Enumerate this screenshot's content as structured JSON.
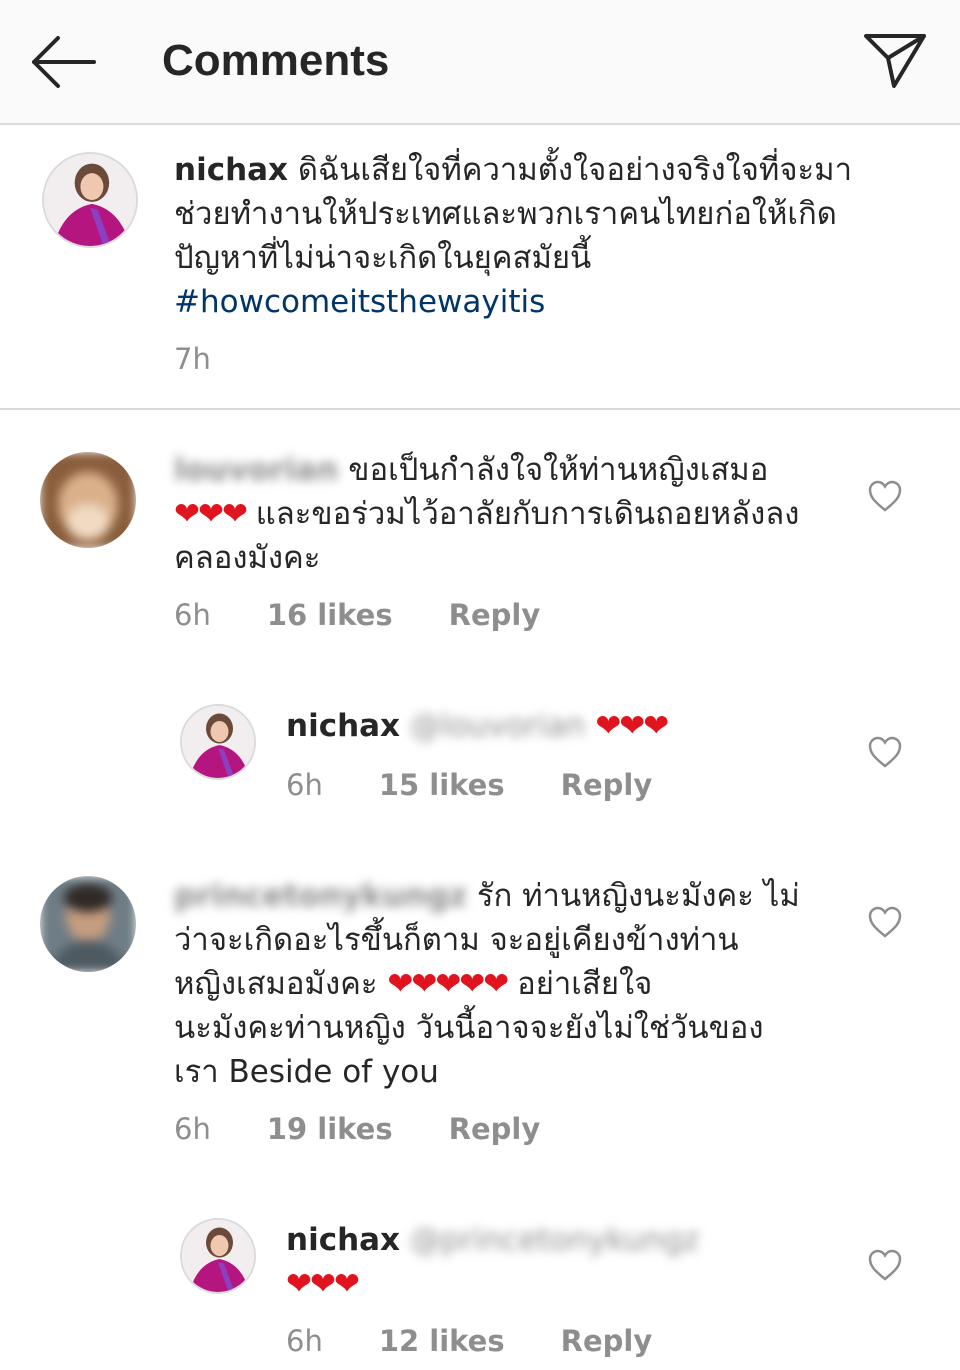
{
  "header": {
    "title": "Comments",
    "back_icon": "arrow-left-icon",
    "share_icon": "paper-plane-icon"
  },
  "caption": {
    "username": "nichax",
    "text": "ดิฉันเสียใจที่ความตั้งใจอย่างจริงใจที่จะมาช่วยทำงานให้ประเทศและพวกเราคนไทยก่อให้เกิดปัญหาที่ไม่น่าจะเกิดในยุคสมัยนี้",
    "hashtag": "#howcomeitsthewayitis",
    "time": "7h"
  },
  "comments": [
    {
      "username": "louvorian",
      "text_before": "ขอเป็นกำลังใจให้ท่านหญิงเสมอ",
      "hearts": "❤❤❤",
      "text_after": "และขอร่วมไว้อาลัยกับการเดินถอยหลังลงคลองมังคะ",
      "time": "6h",
      "likes": "16 likes",
      "reply": "Reply"
    },
    {
      "username": "nichax",
      "mention": "@louvorian",
      "hearts": "❤❤❤",
      "time": "6h",
      "likes": "15 likes",
      "reply": "Reply"
    },
    {
      "username": "princetonykungz",
      "text_1": "รัก ท่านหญิงนะมังคะ ไม่",
      "text_2": "ว่าจะเกิดอะไรขึ้นก็ตาม จะอยู่เคียงข้างท่าน",
      "text_3": "หญิงเสมอมังคะ",
      "hearts": "❤❤❤❤❤",
      "text_4": "อย่าเสียใจ",
      "text_5": "นะมังคะท่านหญิง วันนี้อาจจะยังไม่ใช่วันของ",
      "text_6": "เรา Beside of you",
      "time": "6h",
      "likes": "19 likes",
      "reply": "Reply"
    },
    {
      "username": "nichax",
      "mention": "@princetonykungz",
      "hearts": "❤❤❤",
      "time": "6h",
      "likes": "12 likes",
      "reply": "Reply"
    }
  ],
  "colors": {
    "link": "#003569",
    "muted": "#8e8e8e",
    "heart": "#e0141e",
    "border": "#dbdbdb"
  }
}
